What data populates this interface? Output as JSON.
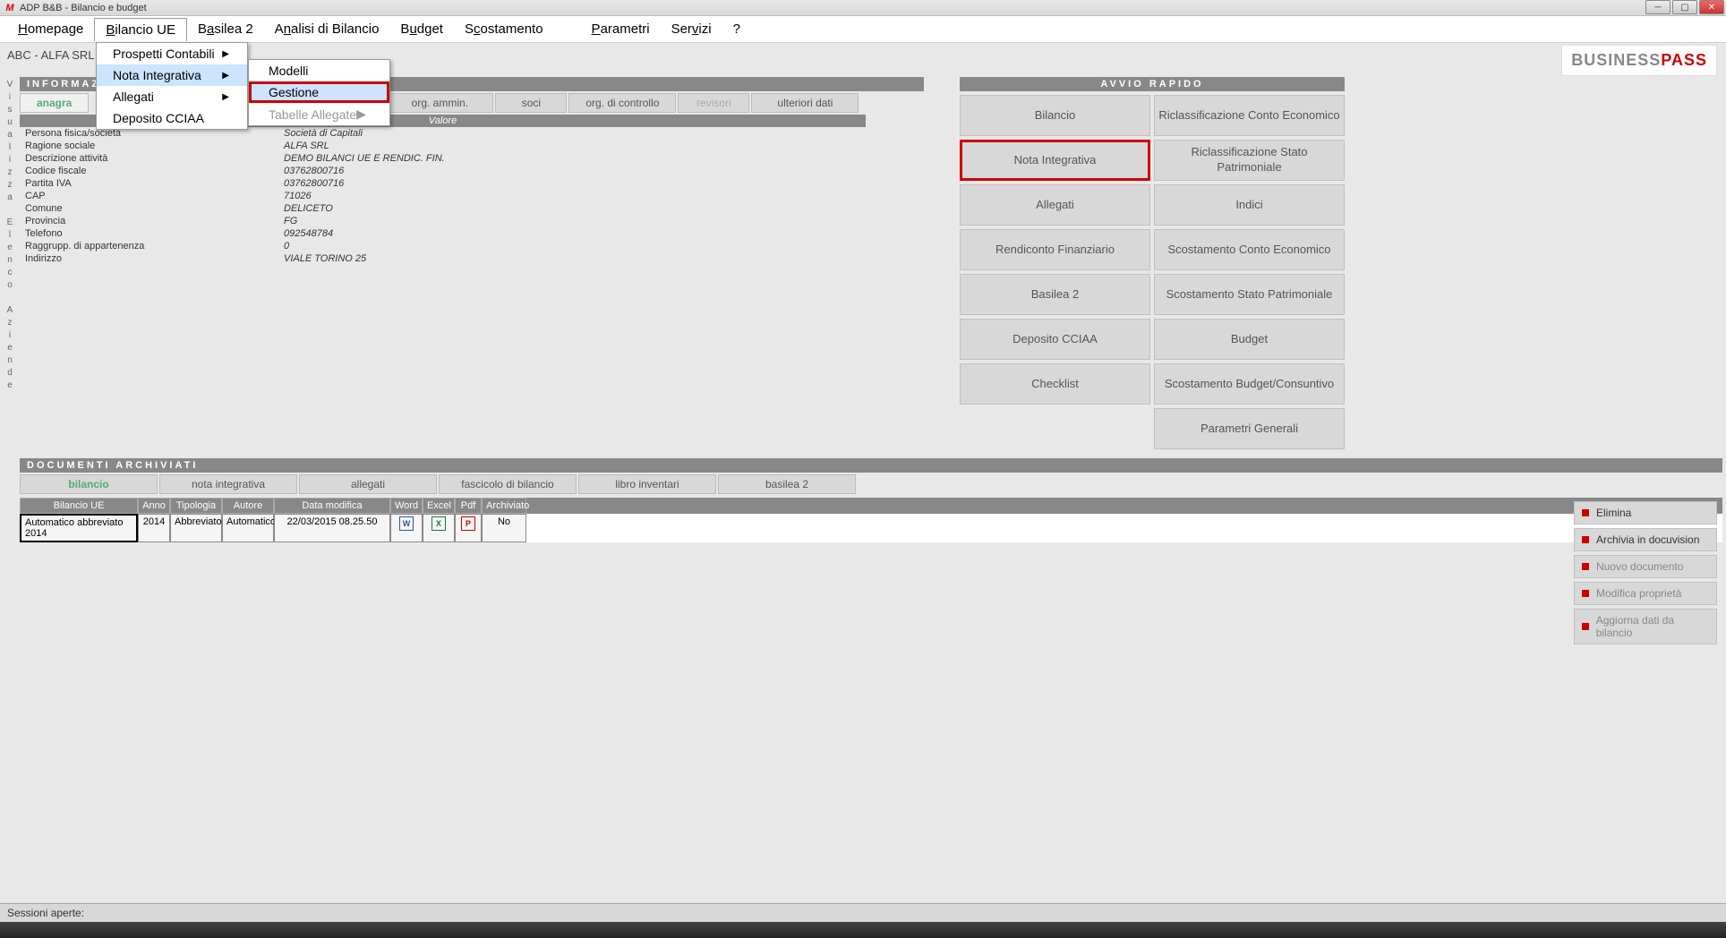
{
  "window": {
    "title": "ADP B&B - Bilancio e budget"
  },
  "menubar": {
    "items": [
      "Homepage",
      "Bilancio UE",
      "Basilea 2",
      "Analisi di Bilancio",
      "Budget",
      "Scostamento",
      "Parametri",
      "Servizi",
      "?"
    ]
  },
  "dropdown": {
    "items": [
      {
        "label": "Prospetti Contabili",
        "arrow": true
      },
      {
        "label": "Nota Integrativa",
        "arrow": true,
        "highlight": true
      },
      {
        "label": "Allegati",
        "arrow": true
      },
      {
        "label": "Deposito CCIAA",
        "arrow": false
      }
    ]
  },
  "submenu": {
    "items": [
      {
        "label": "Modelli"
      },
      {
        "label": "Gestione",
        "highlight": true
      },
      {
        "label": "Tabelle Allegate",
        "arrow": true,
        "disabled": true
      }
    ]
  },
  "breadcrumb": "ABC - ALFA SRL",
  "logo": {
    "part1": "BUSINESS",
    "part2": "PASS"
  },
  "sidebar_letters": [
    "V",
    "i",
    "s",
    "u",
    "a",
    "l",
    "i",
    "z",
    "z",
    "a",
    "",
    "E",
    "l",
    "e",
    "n",
    "c",
    "o",
    "",
    "A",
    "z",
    "i",
    "e",
    "n",
    "d",
    "e"
  ],
  "info_section": {
    "title": "INFORMAZI"
  },
  "info_tabs": [
    "anagra",
    "org. ammin.",
    "soci",
    "org. di controllo",
    "revisori",
    "ulteriori dati"
  ],
  "data_header": "Valore",
  "company_fields": [
    {
      "label": "Persona fisica/società",
      "value": "Società di Capitali"
    },
    {
      "label": "Ragione sociale",
      "value": "ALFA SRL"
    },
    {
      "label": "Descrizione attività",
      "value": "DEMO BILANCI UE E RENDIC. FIN."
    },
    {
      "label": "Codice fiscale",
      "value": "03762800716"
    },
    {
      "label": "Partita IVA",
      "value": "03762800716"
    },
    {
      "label": "CAP",
      "value": "71026"
    },
    {
      "label": "Comune",
      "value": "DELICETO"
    },
    {
      "label": "Provincia",
      "value": "FG"
    },
    {
      "label": "Telefono",
      "value": "092548784"
    },
    {
      "label": "Raggrupp. di appartenenza",
      "value": "0"
    },
    {
      "label": "Indirizzo",
      "value": "VIALE TORINO 25"
    }
  ],
  "quick": {
    "title": "AVVIO RAPIDO",
    "buttons": [
      {
        "label": "Bilancio"
      },
      {
        "label": "Riclassificazione Conto Economico"
      },
      {
        "label": "Nota Integrativa",
        "red": true
      },
      {
        "label": "Riclassificazione Stato Patrimoniale"
      },
      {
        "label": "Allegati"
      },
      {
        "label": "Indici"
      },
      {
        "label": "Rendiconto Finanziario"
      },
      {
        "label": "Scostamento Conto Economico"
      },
      {
        "label": "Basilea 2"
      },
      {
        "label": "Scostamento Stato Patrimoniale"
      },
      {
        "label": "Deposito CCIAA"
      },
      {
        "label": "Budget"
      },
      {
        "label": "Checklist"
      },
      {
        "label": "Scostamento Budget/Consuntivo"
      },
      {
        "label": ""
      },
      {
        "label": "Parametri Generali"
      }
    ]
  },
  "docs": {
    "title": "DOCUMENTI ARCHIVIATI",
    "tabs": [
      "bilancio",
      "nota integrativa",
      "allegati",
      "fascicolo di bilancio",
      "libro inventari",
      "basilea 2"
    ],
    "columns": [
      "Bilancio UE",
      "Anno",
      "Tipologia",
      "Autore",
      "Data modifica",
      "Word",
      "Excel",
      "Pdf",
      "Archiviato"
    ],
    "row": {
      "bilancio": "Automatico abbreviato 2014",
      "anno": "2014",
      "tipologia": "Abbreviato",
      "autore": "Automatico",
      "data": "22/03/2015 08.25.50",
      "archiviato": "No"
    }
  },
  "actions": [
    {
      "label": "Elimina",
      "enabled": true
    },
    {
      "label": "Archivia in docuvision",
      "enabled": true
    },
    {
      "label": "Nuovo documento",
      "enabled": false
    },
    {
      "label": "Modifica proprietà",
      "enabled": false
    },
    {
      "label": "Aggiorna dati da bilancio",
      "enabled": false
    }
  ],
  "statusbar": "Sessioni aperte:"
}
